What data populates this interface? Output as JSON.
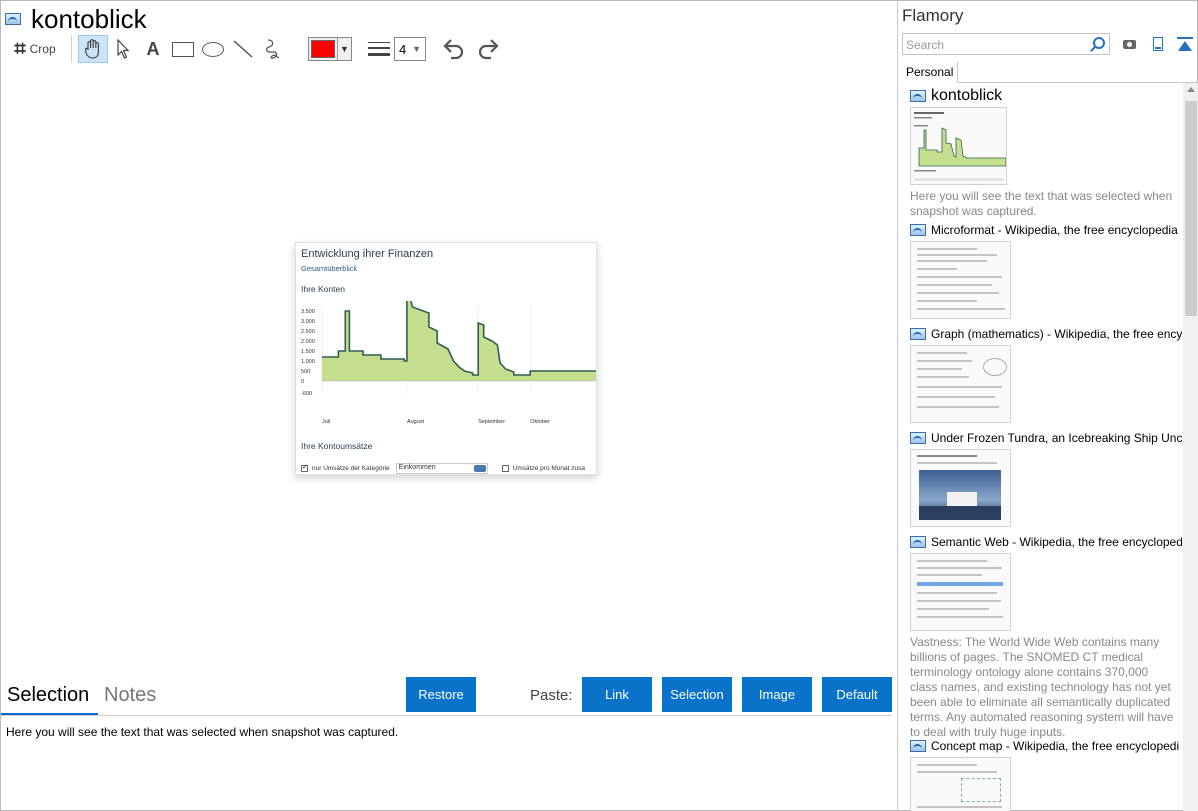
{
  "document": {
    "title": "kontoblick"
  },
  "toolbar": {
    "crop_label": "Crop",
    "pen_color": "#ff0000",
    "line_width": "4"
  },
  "snapshot": {
    "heading": "Entwicklung ihrer Finanzen",
    "subheading": "Gesamtüberblick",
    "section_accounts": "Ihre Konten",
    "section_transactions": "Ihre Kontoumsätze",
    "filter_label": "nur Umsätze der Kategorie",
    "filter_value": "Einkommen",
    "monthly_label": "Umsätze pro Monat zusa",
    "chart_data": {
      "type": "area",
      "title": "Ihre Konten",
      "x_ticks": [
        "Juli",
        "August",
        "September",
        "Oktober"
      ],
      "y_ticks": [
        3500,
        3000,
        2500,
        2000,
        1500,
        1000,
        500,
        0,
        -600
      ],
      "ylim": [
        -600,
        3800
      ],
      "fill_color": "#c5df8f",
      "line_color": "#2f5f50",
      "series": [
        {
          "values": [
            [
              0,
              1200
            ],
            [
              0.06,
              1200
            ],
            [
              0.06,
              1500
            ],
            [
              0.085,
              1500
            ],
            [
              0.085,
              3500
            ],
            [
              0.1,
              3500
            ],
            [
              0.1,
              1500
            ],
            [
              0.15,
              1500
            ],
            [
              0.15,
              1300
            ],
            [
              0.215,
              1300
            ],
            [
              0.215,
              1100
            ],
            [
              0.3,
              1100
            ],
            [
              0.3,
              1000
            ],
            [
              0.31,
              1000
            ],
            [
              0.31,
              4200
            ],
            [
              0.325,
              4000
            ],
            [
              0.33,
              3700
            ],
            [
              0.39,
              3400
            ],
            [
              0.39,
              2700
            ],
            [
              0.42,
              2500
            ],
            [
              0.42,
              1900
            ],
            [
              0.46,
              1600
            ],
            [
              0.48,
              1000
            ],
            [
              0.5,
              700
            ],
            [
              0.52,
              500
            ],
            [
              0.55,
              400
            ],
            [
              0.55,
              300
            ],
            [
              0.57,
              300
            ],
            [
              0.57,
              2900
            ],
            [
              0.59,
              2800
            ],
            [
              0.59,
              2200
            ],
            [
              0.62,
              2000
            ],
            [
              0.64,
              1800
            ],
            [
              0.65,
              900
            ],
            [
              0.67,
              600
            ],
            [
              0.7,
              450
            ],
            [
              0.7,
              300
            ],
            [
              0.76,
              300
            ],
            [
              0.76,
              500
            ],
            [
              1,
              500
            ]
          ]
        }
      ]
    }
  },
  "bottom": {
    "tab_selection": "Selection",
    "tab_notes": "Notes",
    "restore": "Restore",
    "paste_label": "Paste:",
    "paste_link": "Link",
    "paste_selection": "Selection",
    "paste_image": "Image",
    "paste_default": "Default",
    "selection_text": "Here you will see the text that was selected when snapshot was captured."
  },
  "sidebar": {
    "title": "Flamory",
    "search_placeholder": "Search",
    "tab_personal": "Personal",
    "items": [
      {
        "title": "kontoblick",
        "desc": "Here you will see the text that was selected when snapshot was captured."
      },
      {
        "title": "Microformat - Wikipedia, the free encyclopedia",
        "desc": ""
      },
      {
        "title": "Graph (mathematics) - Wikipedia, the free ency",
        "desc": ""
      },
      {
        "title": "Under Frozen Tundra, an Icebreaking Ship Unco",
        "desc": ""
      },
      {
        "title": "Semantic Web - Wikipedia, the free encycloped",
        "desc": "Vastness: The World Wide Web contains many billions of pages. The SNOMED CT medical terminology ontology alone contains 370,000 class names, and existing technology has not yet been able to eliminate all semantically duplicated terms. Any automated reasoning system will have to deal with truly huge inputs."
      },
      {
        "title": "Concept map - Wikipedia, the free encyclopedi",
        "desc": ""
      }
    ]
  }
}
